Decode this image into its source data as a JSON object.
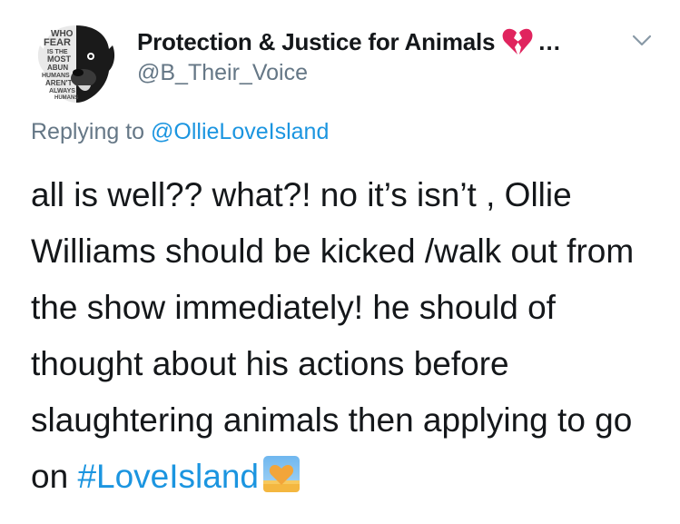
{
  "author": {
    "display_name": "Protection & Justice for Animals",
    "handle": "@B_Their_Voice",
    "name_suffix_icon": "broken-heart-icon",
    "ellipsis": "...",
    "avatar_text": [
      "WHO",
      "FEAR",
      "IS THE",
      "MOST",
      "ABUN",
      "HUMANS",
      "AREN'T",
      "ALWAYS",
      "HUMANS"
    ]
  },
  "reply": {
    "prefix": "Replying to ",
    "mention": "@OllieLoveIsland"
  },
  "tweet": {
    "text": "all is well?? what?! no it’s isn’t , Ollie Williams should be kicked /walk out from the show immediately! he should of thought about his actions before slaughtering animals then applying to go on ",
    "hashtag": "#LoveIsland",
    "trailing_icon": "heart-on-sunset-icon"
  },
  "colors": {
    "link": "#1b95e0",
    "secondary_text": "#657786",
    "primary_text": "#14171a",
    "broken_heart": "#e0245e"
  }
}
